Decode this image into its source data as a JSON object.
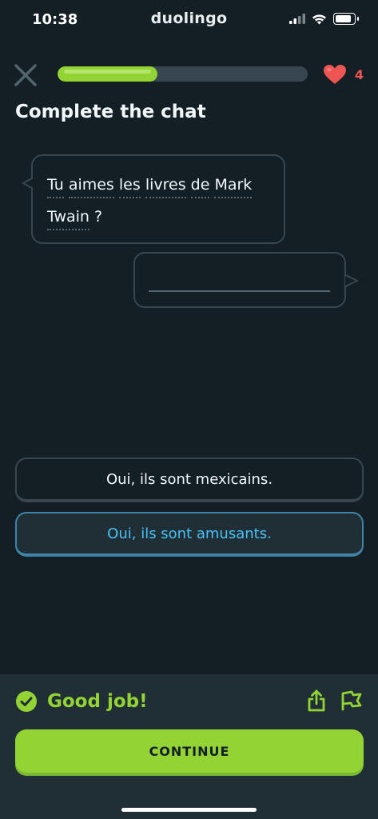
{
  "status_bar": {
    "time": "10:38",
    "app_name": "duolingo",
    "icons": [
      "signal-icon",
      "wifi-icon",
      "battery-icon"
    ]
  },
  "lesson": {
    "progress": 0.4,
    "hearts": "4",
    "title": "Complete the chat"
  },
  "chat": {
    "prompt_words": [
      "Tu",
      "aimes",
      "les",
      "livres",
      "de",
      "Mark",
      "Twain",
      "?"
    ],
    "answer_blank": ""
  },
  "options": [
    {
      "label": "Oui, ils sont mexicains.",
      "selected": false
    },
    {
      "label": "Oui, ils sont amusants.",
      "selected": true
    }
  ],
  "feedback": {
    "message": "Good job!",
    "continue_label": "CONTINUE",
    "icons": [
      "check-circle-icon",
      "share-icon",
      "flag-icon"
    ]
  },
  "colors": {
    "background": "#131f24",
    "accent_green": "#93d333",
    "selected_blue": "#49c0f8",
    "heart_red": "#ee5555",
    "panel": "#202f36"
  }
}
